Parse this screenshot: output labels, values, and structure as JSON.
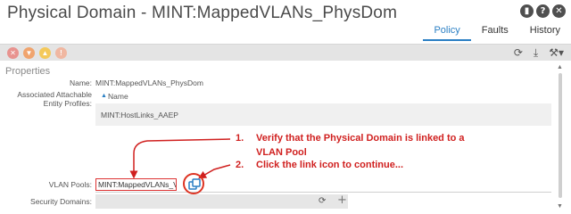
{
  "header": {
    "title": "Physical Domain - MINT:MappedVLANs_PhysDom",
    "tabs": [
      {
        "label": "Policy",
        "active": true
      },
      {
        "label": "Faults",
        "active": false
      },
      {
        "label": "History",
        "active": false
      }
    ]
  },
  "toolbar": {
    "fault_dots": [
      {
        "icon": "critical-fault-icon",
        "color": "#e8938f"
      },
      {
        "icon": "major-fault-icon",
        "color": "#f0a46e"
      },
      {
        "icon": "minor-fault-icon",
        "color": "#f4c95a"
      },
      {
        "icon": "warning-fault-icon",
        "color": "#f0b7a1"
      }
    ],
    "actions": [
      "refresh-icon",
      "download-icon",
      "tools-icon"
    ]
  },
  "properties": {
    "section_label": "Properties",
    "name_label": "Name:",
    "name_value": "MINT:MappedVLANs_PhysDom",
    "aaep_label_line1": "Associated Attachable",
    "aaep_label_line2": "Entity Profiles:",
    "aaep_column": "Name",
    "aaep_rows": [
      "MINT:HostLinks_AAEP"
    ],
    "vlan_pools_label": "VLAN Pools:",
    "vlan_pools_value": "MINT:MappedVLANs_Vl",
    "security_domains_label": "Security Domains:"
  },
  "annotations": {
    "step1_num": "1.",
    "step1_line1": "Verify that the Physical Domain is linked to a",
    "step1_line2": "VLAN Pool",
    "step2_num": "2.",
    "step2_line1": "Click the link icon to continue...",
    "color": "#d0201f"
  },
  "colors": {
    "accent": "#2a7fc4",
    "toolbar_bg": "#e4e4e4"
  }
}
